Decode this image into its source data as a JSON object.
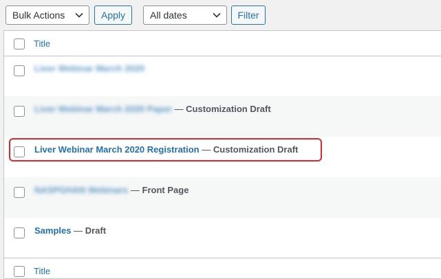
{
  "toolbar": {
    "bulk_actions": "Bulk Actions",
    "apply": "Apply",
    "dates": "All dates",
    "filter": "Filter"
  },
  "table": {
    "header_title": "Title",
    "footer_title": "Title",
    "rows": [
      {
        "title": "Liver Webinar March 2020",
        "dash": "",
        "state": ""
      },
      {
        "title": "Liver Webinar March 2020 Paper",
        "dash": "—",
        "state": "Customization Draft"
      },
      {
        "title": "Liver Webinar March 2020 Registration",
        "dash": "—",
        "state": "Customization Draft"
      },
      {
        "title": "NASPGHAN Webinars",
        "dash": "—",
        "state": "Front Page"
      },
      {
        "title": "Samples",
        "dash": "—",
        "state": "Draft"
      }
    ]
  },
  "colors": {
    "link": "#2271b1",
    "highlight": "#e0252c",
    "row_alt": "#f6f7f7"
  }
}
